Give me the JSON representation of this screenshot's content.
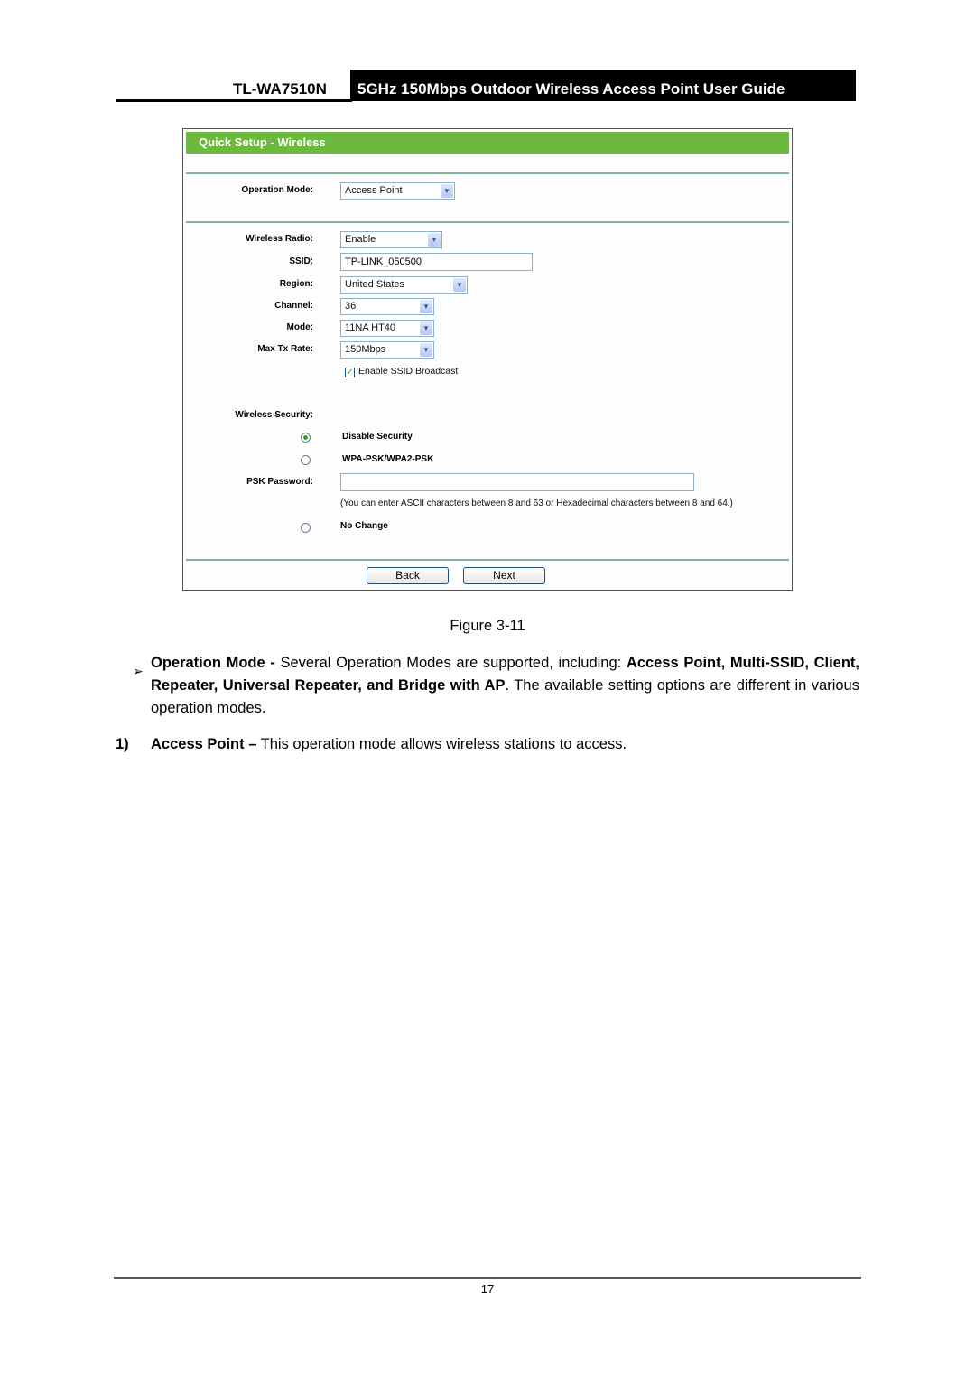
{
  "header": {
    "model": "TL-WA7510N",
    "guide_title": "5GHz 150Mbps Outdoor Wireless Access Point User Guide"
  },
  "figure": {
    "panel_title": "Quick Setup - Wireless",
    "operation_mode": {
      "label": "Operation Mode:",
      "value": "Access Point"
    },
    "wireless_radio": {
      "label": "Wireless Radio:",
      "value": "Enable"
    },
    "ssid": {
      "label": "SSID:",
      "value": "TP-LINK_050500"
    },
    "region": {
      "label": "Region:",
      "value": "United States"
    },
    "channel": {
      "label": "Channel:",
      "value": "36"
    },
    "mode": {
      "label": "Mode:",
      "value": "11NA HT40"
    },
    "max_tx_rate": {
      "label": "Max Tx Rate:",
      "value": "150Mbps"
    },
    "ssid_broadcast": {
      "label": "Enable SSID Broadcast",
      "checked": true
    },
    "wireless_security": {
      "label": "Wireless Security:",
      "options": [
        {
          "label": "Disable Security",
          "selected": true
        },
        {
          "label": "WPA-PSK/WPA2-PSK",
          "selected": false
        },
        {
          "label": "No Change",
          "selected": false
        }
      ]
    },
    "psk_password": {
      "label": "PSK Password:",
      "value": "",
      "hint": "(You can enter ASCII characters between 8 and 63 or Hexadecimal characters between 8 and 64.)"
    },
    "buttons": {
      "back": "Back",
      "next": "Next"
    },
    "caption": "Figure 3-11"
  },
  "body": {
    "bullet_symbol": "➢",
    "operation_mode_para": {
      "term": "Operation Mode -",
      "text1": " Several Operation Modes are supported, including: ",
      "modes": "Access Point, Multi-SSID, Client, Repeater, Universal Repeater, and Bridge with AP",
      "text2": ". The available setting options are different in various operation modes."
    },
    "item1": {
      "number": "1)",
      "term": "Access Point –",
      "text": " This operation mode allows wireless stations to access."
    }
  },
  "footer": {
    "page_number": "17"
  }
}
